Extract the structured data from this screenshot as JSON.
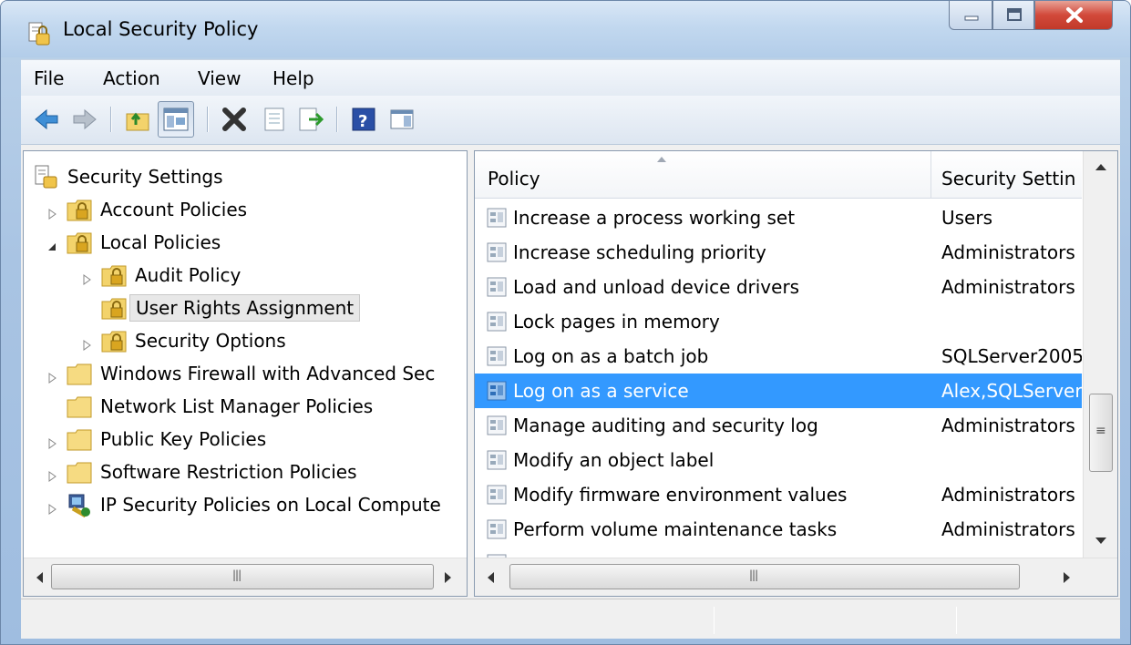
{
  "window": {
    "title": "Local Security Policy",
    "icon": "security-policy-icon"
  },
  "menu": {
    "items": [
      "File",
      "Action",
      "View",
      "Help"
    ]
  },
  "toolbar": {
    "buttons": [
      "back-arrow-icon",
      "forward-arrow-icon",
      "up-folder-icon",
      "show-hide-tree-icon",
      "delete-icon",
      "properties-icon",
      "export-list-icon",
      "help-icon",
      "show-action-pane-icon"
    ]
  },
  "tree": {
    "items": [
      {
        "label": "Security Settings",
        "icon": "security-settings-icon",
        "expander": "none"
      },
      {
        "label": "Account Policies",
        "icon": "folder-lock-icon",
        "expander": "collapsed"
      },
      {
        "label": "Local Policies",
        "icon": "folder-lock-icon",
        "expander": "expanded"
      },
      {
        "label": "Audit Policy",
        "icon": "folder-lock-icon",
        "expander": "collapsed"
      },
      {
        "label": "User Rights Assignment",
        "icon": "folder-lock-icon",
        "expander": "none",
        "selected": true
      },
      {
        "label": "Security Options",
        "icon": "folder-lock-icon",
        "expander": "collapsed"
      },
      {
        "label": "Windows Firewall with Advanced Sec",
        "icon": "folder-icon",
        "expander": "collapsed"
      },
      {
        "label": "Network List Manager Policies",
        "icon": "folder-icon",
        "expander": "none"
      },
      {
        "label": "Public Key Policies",
        "icon": "folder-icon",
        "expander": "collapsed"
      },
      {
        "label": "Software Restriction Policies",
        "icon": "folder-icon",
        "expander": "collapsed"
      },
      {
        "label": "IP Security Policies on Local Compute",
        "icon": "ip-security-icon",
        "expander": "collapsed"
      }
    ]
  },
  "list": {
    "columns": [
      "Policy",
      "Security Settin"
    ],
    "rows": [
      {
        "policy": "Increase a process working set",
        "setting": "Users"
      },
      {
        "policy": "Increase scheduling priority",
        "setting": "Administrators"
      },
      {
        "policy": "Load and unload device drivers",
        "setting": "Administrators"
      },
      {
        "policy": "Lock pages in memory",
        "setting": ""
      },
      {
        "policy": "Log on as a batch job",
        "setting": "SQLServer2005"
      },
      {
        "policy": "Log on as a service",
        "setting": "Alex,SQLServer",
        "selected": true
      },
      {
        "policy": "Manage auditing and security log",
        "setting": "Administrators"
      },
      {
        "policy": "Modify an object label",
        "setting": ""
      },
      {
        "policy": "Modify firmware environment values",
        "setting": "Administrators"
      },
      {
        "policy": "Perform volume maintenance tasks",
        "setting": "Administrators"
      }
    ]
  },
  "colors": {
    "selection": "#3399ff",
    "folder": "#f3d36b",
    "close": "#c13a2a"
  }
}
